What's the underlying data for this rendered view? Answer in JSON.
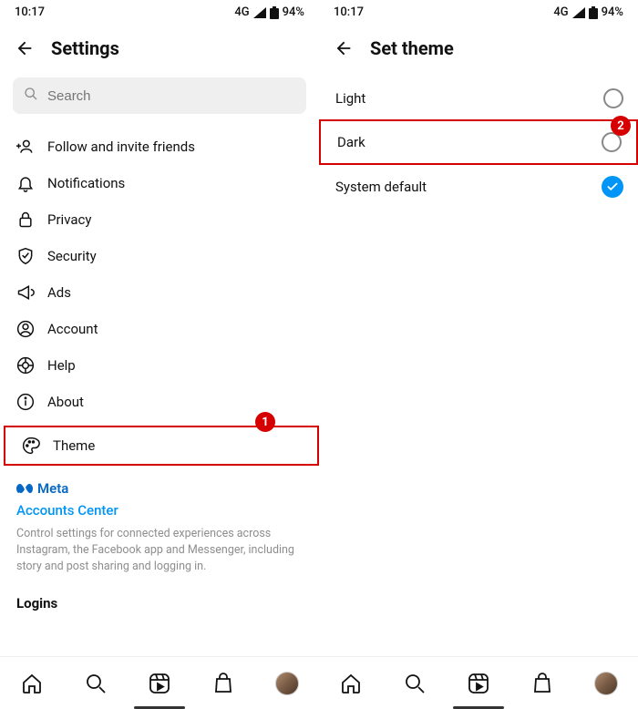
{
  "statusbar": {
    "time": "10:17",
    "network_label": "4G",
    "battery_percent": "94%"
  },
  "left": {
    "title": "Settings",
    "search_placeholder": "Search",
    "items": [
      {
        "label": "Follow and invite friends"
      },
      {
        "label": "Notifications"
      },
      {
        "label": "Privacy"
      },
      {
        "label": "Security"
      },
      {
        "label": "Ads"
      },
      {
        "label": "Account"
      },
      {
        "label": "Help"
      },
      {
        "label": "About"
      },
      {
        "label": "Theme"
      }
    ],
    "meta_brand": "Meta",
    "accounts_center": "Accounts Center",
    "meta_description": "Control settings for connected experiences across Instagram, the Facebook app and Messenger, including story and post sharing and logging in.",
    "logins_label": "Logins",
    "annotation_badge": "1"
  },
  "right": {
    "title": "Set theme",
    "options": [
      {
        "label": "Light",
        "selected": false
      },
      {
        "label": "Dark",
        "selected": false
      },
      {
        "label": "System default",
        "selected": true
      }
    ],
    "annotation_badge": "2"
  }
}
